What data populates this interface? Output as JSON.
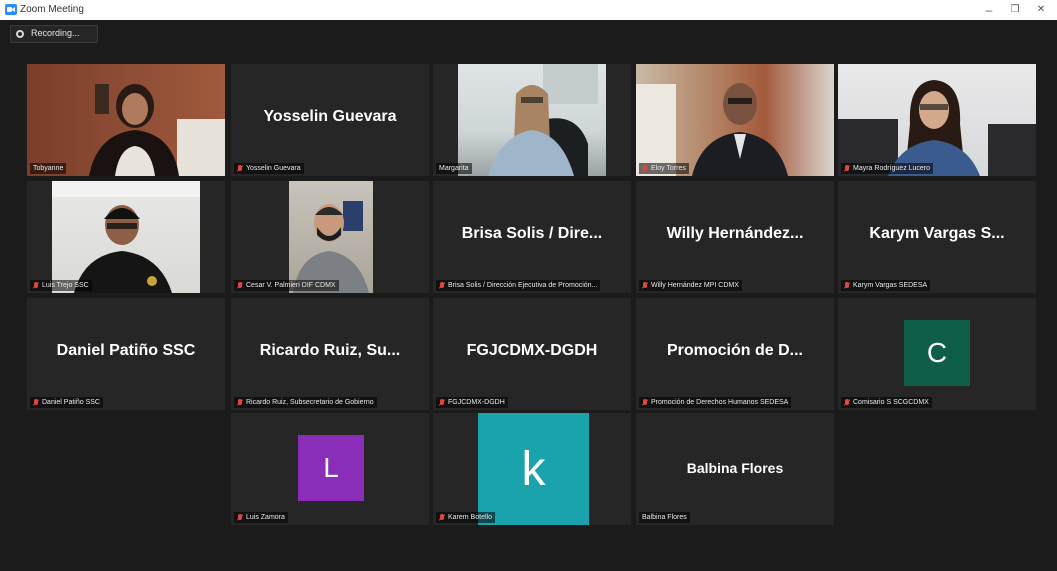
{
  "window": {
    "title": "Zoom Meeting",
    "minimize": "–",
    "restore": "❐",
    "close": "✕"
  },
  "recording": {
    "label": "Recording..."
  },
  "participants": [
    {
      "display": "",
      "label": "Tobyanne"
    },
    {
      "display": "Yosselin Guevara",
      "label": "Yosselin Guevara"
    },
    {
      "display": "",
      "label": "Margarita"
    },
    {
      "display": "",
      "label": "Eloy Torres"
    },
    {
      "display": "",
      "label": "Mayra Rodríguez Lucero"
    },
    {
      "display": "",
      "label": "Luis Trejo SSC"
    },
    {
      "display": "",
      "label": "Cesar V. Palmieri DIF CDMX"
    },
    {
      "display": "Brisa Solis / Dire...",
      "label": "Brisa Solis / Dirección Ejecutiva de Promoción..."
    },
    {
      "display": "Willy  Hernández...",
      "label": "Willy Hernández MPI CDMX"
    },
    {
      "display": "Karym Vargas S...",
      "label": "Karym Vargas SEDESA"
    },
    {
      "display": "Daniel Patiño SSC",
      "label": "Daniel Patiño SSC"
    },
    {
      "display": "Ricardo Ruiz, Su...",
      "label": "Ricardo Ruiz, Subsecretario de Gobierno"
    },
    {
      "display": "FGJCDMX-DGDH",
      "label": "FGJCDMX-DGDH"
    },
    {
      "display": "Promoción de D...",
      "label": "Promoción de Derechos Humanos SEDESA"
    },
    {
      "display": "C",
      "label": "Comisario S SCGCDMX",
      "avatar_color": "#0f5e4a"
    },
    {
      "display": "L",
      "label": "Luis Zamora",
      "avatar_color": "#8a2db8"
    },
    {
      "display": "k",
      "label": "Karem Botello",
      "avatar_color": "#1aa3ad"
    },
    {
      "display": "Balbina Flores",
      "label": "Balbina Flores"
    }
  ],
  "colors": {
    "active_border": "#b9d948",
    "tile_bg": "#262626",
    "app_bg": "#1b1b1b",
    "mic_muted": "#e0463e"
  }
}
